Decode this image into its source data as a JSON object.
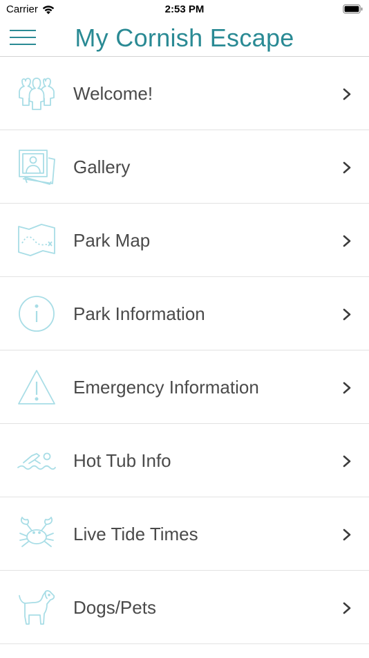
{
  "status_bar": {
    "carrier": "Carrier",
    "time": "2:53 PM",
    "wifi_icon": "wifi-icon",
    "battery_icon": "battery-icon"
  },
  "nav": {
    "title": "My Cornish Escape",
    "menu_icon": "hamburger-menu-icon"
  },
  "colors": {
    "accent": "#2a8a94",
    "icon_stroke": "#a8dde6",
    "label": "#4a4a4a",
    "divider": "#e2e2e2"
  },
  "menu_items": [
    {
      "label": "Welcome!",
      "icon": "people-group-icon"
    },
    {
      "label": "Gallery",
      "icon": "photo-stack-icon"
    },
    {
      "label": "Park Map",
      "icon": "treasure-map-icon"
    },
    {
      "label": "Park Information",
      "icon": "info-circle-icon"
    },
    {
      "label": "Emergency Information",
      "icon": "warning-triangle-icon"
    },
    {
      "label": "Hot Tub Info",
      "icon": "swimmer-icon"
    },
    {
      "label": "Live Tide Times",
      "icon": "crab-icon"
    },
    {
      "label": "Dogs/Pets",
      "icon": "dog-icon"
    }
  ]
}
